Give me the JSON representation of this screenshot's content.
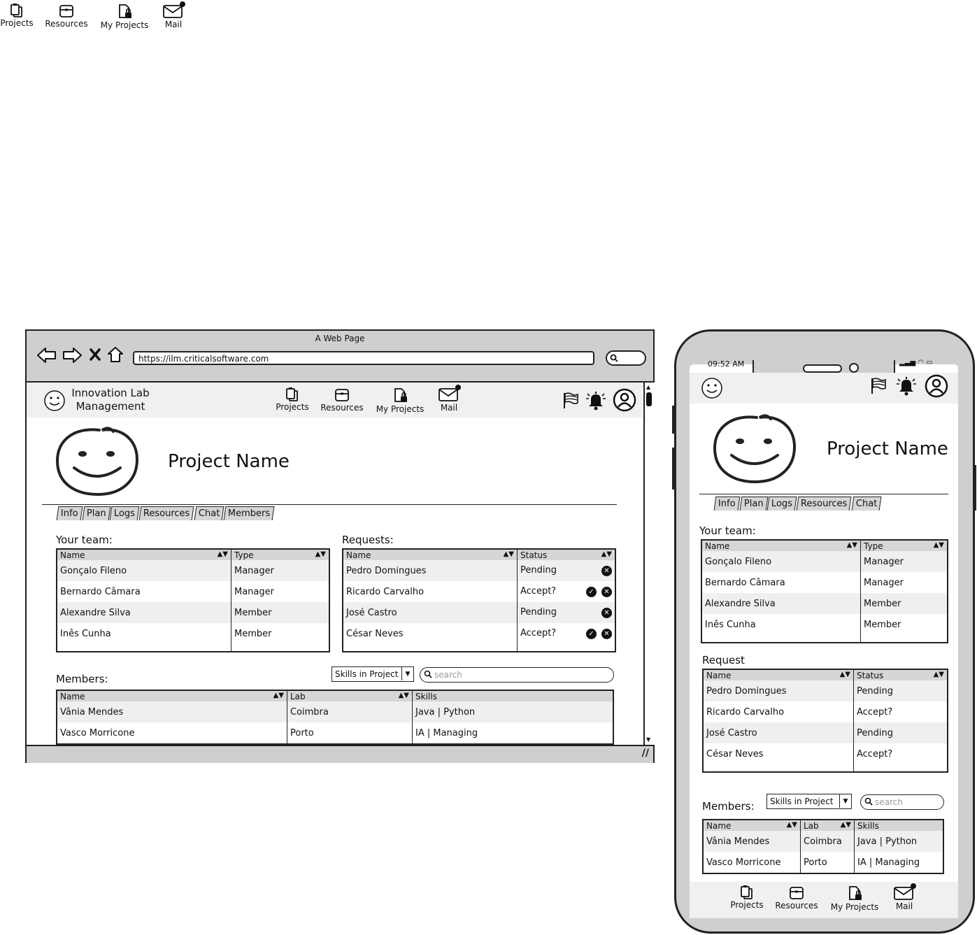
{
  "top_nav": {
    "projects": "Projects",
    "resources": "Resources",
    "my_projects": "My Projects",
    "mail": "Mail"
  },
  "browser": {
    "title": "A Web Page",
    "url": "https://ilm.criticalsoftware.com",
    "app_title_line1": "Innovation Lab",
    "app_title_line2": "Management",
    "nav": {
      "projects": "Projects",
      "resources": "Resources",
      "my_projects": "My Projects",
      "mail": "Mail"
    },
    "project_name": "Project Name",
    "tabs": [
      "Info",
      "Plan",
      "Logs",
      "Resources",
      "Chat",
      "Members"
    ],
    "team_label": "Your team:",
    "team_headers": {
      "name": "Name",
      "type": "Type"
    },
    "team_rows": [
      {
        "name": "Gonçalo Fileno",
        "type": "Manager"
      },
      {
        "name": "Bernardo Câmara",
        "type": "Manager"
      },
      {
        "name": "Alexandre Silva",
        "type": "Member"
      },
      {
        "name": "Inês Cunha",
        "type": "Member"
      }
    ],
    "requests_label": "Requests:",
    "requests_headers": {
      "name": "Name",
      "status": "Status"
    },
    "requests_rows": [
      {
        "name": "Pedro Domingues",
        "status": "Pending"
      },
      {
        "name": "Ricardo Carvalho",
        "status": "Accept?"
      },
      {
        "name": "José Castro",
        "status": "Pending"
      },
      {
        "name": "César Neves",
        "status": "Accept?"
      }
    ],
    "members_label": "Members:",
    "skills_dropdown": "Skills in Project",
    "search_placeholder": "search",
    "members_headers": {
      "name": "Name",
      "lab": "Lab",
      "skills": "Skills"
    },
    "members_rows": [
      {
        "name": "Vânia Mendes",
        "lab": "Coimbra",
        "skills": "Java | Python"
      },
      {
        "name": "Vasco Morricone",
        "lab": "Porto",
        "skills": "IA | Managing"
      }
    ]
  },
  "phone": {
    "time": "09:52 AM",
    "project_name": "Project Name",
    "tabs": [
      "Info",
      "Plan",
      "Logs",
      "Resources",
      "Chat"
    ],
    "team_label": "Your team:",
    "team_headers": {
      "name": "Name",
      "type": "Type"
    },
    "team_rows": [
      {
        "name": "Gonçalo Fileno",
        "type": "Manager"
      },
      {
        "name": "Bernardo Câmara",
        "type": "Manager"
      },
      {
        "name": "Alexandre Silva",
        "type": "Member"
      },
      {
        "name": "Inês Cunha",
        "type": "Member"
      }
    ],
    "request_label": "Request",
    "request_headers": {
      "name": "Name",
      "status": "Status"
    },
    "request_rows": [
      {
        "name": "Pedro Domingues",
        "status": "Pending"
      },
      {
        "name": "Ricardo Carvalho",
        "status": "Accept?"
      },
      {
        "name": "José Castro",
        "status": "Pending"
      },
      {
        "name": "César Neves",
        "status": "Accept?"
      }
    ],
    "members_label": "Members:",
    "skills_dropdown": "Skills in Project",
    "search_placeholder": "search",
    "members_headers": {
      "name": "Name",
      "lab": "Lab",
      "skills": "Skills"
    },
    "members_rows": [
      {
        "name": "Vânia Mendes",
        "lab": "Coimbra",
        "skills": "Java | Python"
      },
      {
        "name": "Vasco Morricone",
        "lab": "Porto",
        "skills": "IA | Managing"
      }
    ],
    "bottom_nav": {
      "projects": "Projects",
      "resources": "Resources",
      "my_projects": "My Projects",
      "mail": "Mail"
    }
  },
  "icons": [
    "clipboard-icon",
    "box-icon",
    "locked-file-icon",
    "mail-icon",
    "smiley-icon",
    "flag-icon",
    "bell-icon",
    "user-icon",
    "back-icon",
    "forward-icon",
    "close-icon",
    "home-icon",
    "search-icon",
    "check-icon",
    "sort-icon"
  ]
}
